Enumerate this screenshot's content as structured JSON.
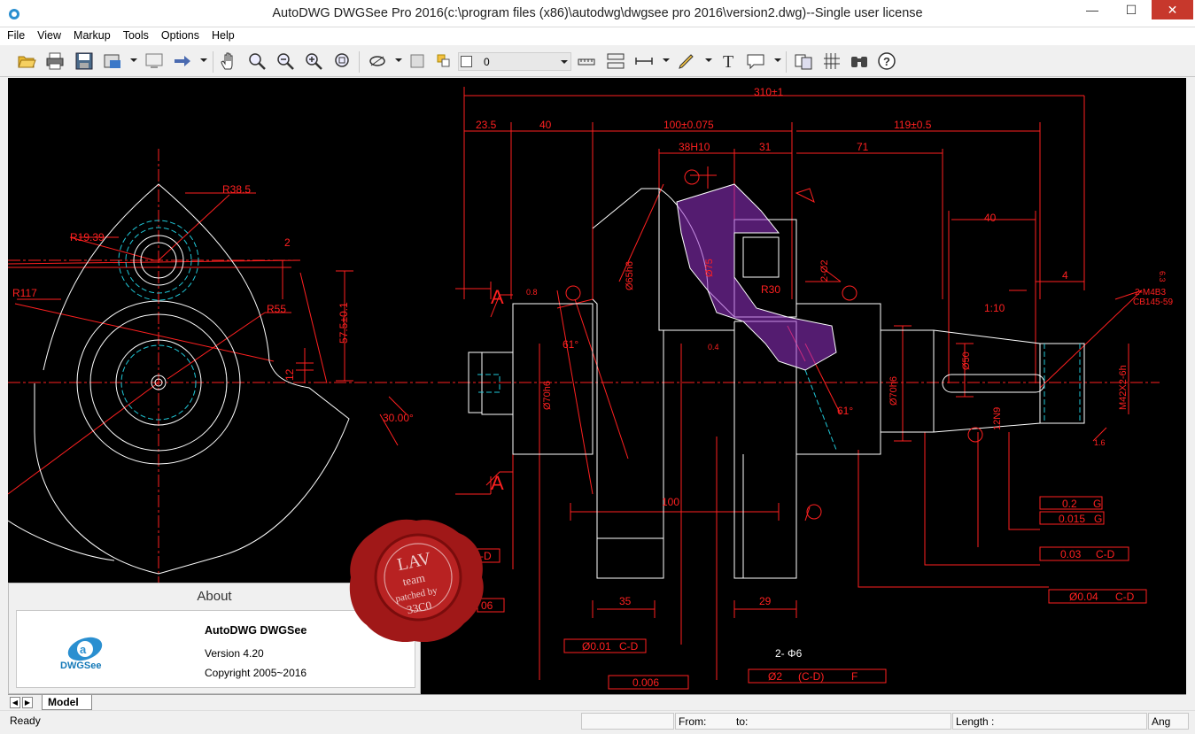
{
  "window": {
    "title": "AutoDWG DWGSee Pro 2016(c:\\program files (x86)\\autodwg\\dwgsee pro 2016\\version2.dwg)--Single user license",
    "minimize": "—",
    "maximize": "☐",
    "close": "✕"
  },
  "menu": {
    "items": [
      "File",
      "View",
      "Markup",
      "Tools",
      "Options",
      "Help"
    ]
  },
  "toolbar": {
    "layer_value": "0",
    "icons": [
      "open-icon",
      "print-icon",
      "save-icon",
      "export-icon",
      "screen-icon",
      "arrow-icon",
      "pan-hand-icon",
      "zoom-window-icon",
      "zoom-out-icon",
      "zoom-in-icon",
      "zoom-extents-icon",
      "layer-icon",
      "layer-state-icon",
      "measure-distance-icon",
      "measure-area-icon",
      "dimension-icon",
      "pen-icon",
      "text-icon",
      "comment-icon",
      "compare-icon",
      "hatch-icon",
      "find-icon",
      "help-icon"
    ]
  },
  "drawing": {
    "dims": [
      "310±1",
      "23.5",
      "40",
      "100±0.075",
      "119±0.5",
      "38H10",
      "31",
      "71",
      "40",
      "4",
      "R38.5",
      "R19.39",
      "R117",
      "R55",
      "2",
      "57.5±0.1",
      "12",
      "30.00°",
      "61°",
      "61°",
      "1:10",
      "R30",
      "100",
      "35",
      "29",
      "2- Φ6",
      "A",
      "A",
      "M42X2-6h",
      "2-M4B3",
      "CB145-59",
      "0.8",
      "0.4",
      "6.3",
      "1.6",
      "Ø70h6",
      "Ø65h6",
      "Ø75",
      "Ø50",
      "Ø70h6",
      "12N9",
      "2-Ø2"
    ],
    "tolerance_frames": [
      "0.2",
      "G",
      "0.015",
      "G",
      "0.03",
      "C-D",
      "Ø0.04",
      "C-D",
      "Ø0.01",
      "C-D",
      "0.006",
      "Ø2",
      "(C-D)",
      "F",
      "-D",
      "06"
    ]
  },
  "about": {
    "title": "About",
    "product": "AutoDWG DWGSee",
    "version": "Version 4.20",
    "copyright": "Copyright 2005~2016",
    "logo_text": "DWGSee"
  },
  "seal": {
    "line1": "LAV",
    "line2": "team",
    "line3": "patched by",
    "line4": "33C0"
  },
  "tabs": {
    "model": "Model"
  },
  "status": {
    "ready": "Ready",
    "from": "From:",
    "to": "to:",
    "length": "Length :",
    "ang": "Ang"
  },
  "colors": {
    "drawing_bg": "#000000",
    "red": "#ff2020",
    "white": "#ffffff",
    "cyan": "#20c8d8",
    "hatch": "#9933cc",
    "close_btn": "#c7382c"
  }
}
